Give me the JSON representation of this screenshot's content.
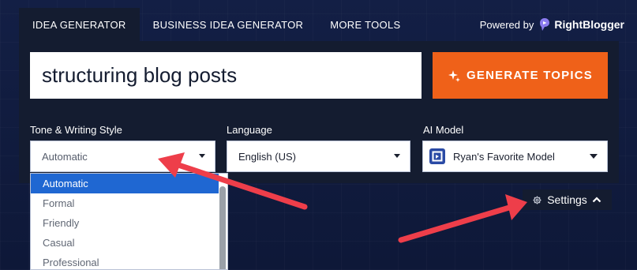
{
  "tabs": [
    {
      "label": "IDEA GENERATOR",
      "active": true
    },
    {
      "label": "BUSINESS IDEA GENERATOR",
      "active": false
    },
    {
      "label": "MORE TOOLS",
      "active": false
    }
  ],
  "powered_by": {
    "prefix": "Powered by",
    "brand": "RightBlogger"
  },
  "search": {
    "value": "structuring blog posts"
  },
  "generate_button": {
    "label": "GENERATE TOPICS"
  },
  "fields": {
    "tone": {
      "label": "Tone & Writing Style",
      "value": "Automatic"
    },
    "language": {
      "label": "Language",
      "value": "English (US)"
    },
    "ai_model": {
      "label": "AI Model",
      "value": "Ryan's Favorite Model"
    }
  },
  "tone_options": [
    "Automatic",
    "Formal",
    "Friendly",
    "Casual",
    "Professional"
  ],
  "settings": {
    "label": "Settings"
  },
  "colors": {
    "background": "#0f1b3d",
    "panel": "#141c30",
    "accent": "#ef6119",
    "selection": "#1f67d2",
    "annotation_arrow": "#ee3e4a"
  }
}
